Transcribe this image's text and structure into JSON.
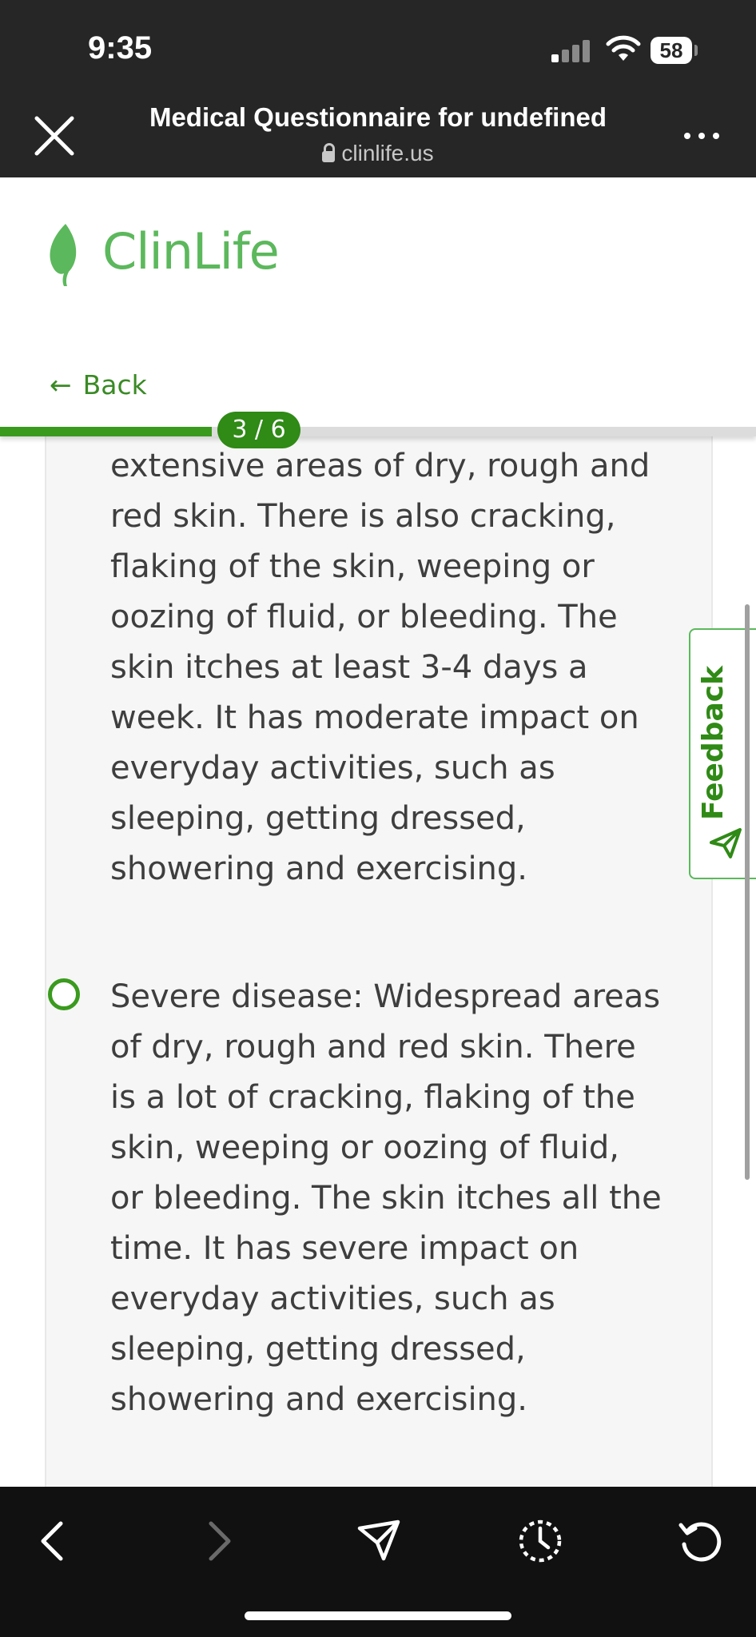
{
  "status_bar": {
    "time": "9:35",
    "battery": "58"
  },
  "browser": {
    "title": "Medical Questionnaire for undefined",
    "url": "clinlife.us",
    "icons": [
      "close-icon",
      "more-icon",
      "lock-icon"
    ]
  },
  "site": {
    "logo_text": "ClinLife",
    "back_label": "Back",
    "brand_color": "#5cb85c",
    "accent_color": "#3a9a1e"
  },
  "progress": {
    "label": "3 / 6",
    "fraction": 0.5
  },
  "options": [
    {
      "text": "extensive areas of dry, rough and red skin. There is also cracking, flaking of the skin, weeping or oozing of fluid, or bleeding. The skin itches at least 3-4 days a week. It has moderate impact on everyday activities, such as sleeping, getting dressed, showering and exercising.",
      "selected": false
    },
    {
      "text": "Severe disease: Widespread areas of dry, rough and red skin. There is a lot of cracking, flaking of the skin, weeping or oozing of fluid, or bleeding. The skin itches all the time. It has severe impact on everyday activities, such as sleeping, getting dressed, showering and exercising.",
      "selected": false
    }
  ],
  "feedback": {
    "label": "Feedback"
  },
  "toolbar": {
    "icons": [
      "back-icon",
      "forward-icon",
      "share-icon",
      "history-icon",
      "reload-icon"
    ]
  }
}
